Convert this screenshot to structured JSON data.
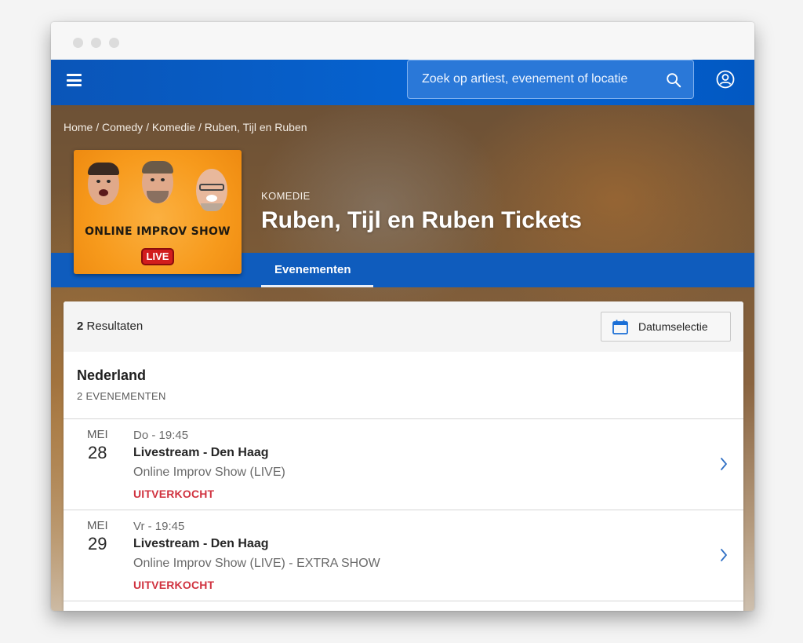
{
  "window": {
    "controls": [
      "close",
      "minimize",
      "maximize"
    ]
  },
  "topnav": {
    "menu_icon": "hamburger-menu-icon",
    "search": {
      "placeholder": "Zoek op artiest, evenement of locatie",
      "icon": "search-icon"
    },
    "account_icon": "user-account-icon"
  },
  "breadcrumb": [
    {
      "label": "Home"
    },
    {
      "label": "Comedy"
    },
    {
      "label": "Komedie"
    },
    {
      "label": "Ruben, Tijl en Ruben"
    }
  ],
  "breadcrumb_separator": "/",
  "artist": {
    "category": "KOMEDIE",
    "title": "Ruben, Tijl en Ruben Tickets",
    "poster": {
      "headline": "ONLINE IMPROV SHOW",
      "badge": "LIVE"
    }
  },
  "tabs": [
    {
      "label": "Evenementen",
      "active": true
    }
  ],
  "results": {
    "count": "2",
    "label": "Resultaten",
    "date_button": "Datumselectie",
    "date_icon": "calendar-icon"
  },
  "group": {
    "country": "Nederland",
    "count_label": "2 EVENEMENTEN"
  },
  "events": [
    {
      "month": "MEI",
      "day": "28",
      "time": "Do - 19:45",
      "venue": "Livestream - Den Haag",
      "name": "Online Improv Show (LIVE)",
      "status": "UITVERKOCHT"
    },
    {
      "month": "MEI",
      "day": "29",
      "time": "Vr - 19:45",
      "venue": "Livestream - Den Haag",
      "name": "Online Improv Show (LIVE) - EXTRA SHOW",
      "status": "UITVERKOCHT"
    }
  ],
  "colors": {
    "brand_blue": "#0565d4",
    "tab_blue": "#0f5cbd",
    "sold_out_red": "#d0323f",
    "poster_orange": "#f79a1c"
  }
}
